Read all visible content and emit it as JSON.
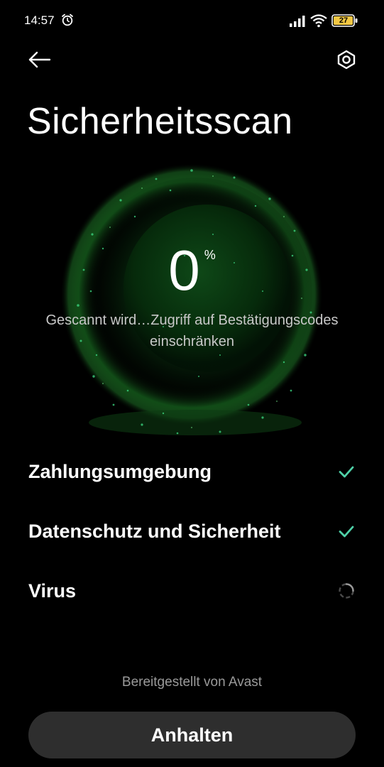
{
  "status_bar": {
    "time": "14:57",
    "battery_level": "27",
    "icons": [
      "alarm-icon",
      "signal-icon",
      "wifi-icon",
      "battery-icon"
    ]
  },
  "header": {
    "back_icon": "arrow-left-icon",
    "settings_icon": "gear-icon",
    "title": "Sicherheitsscan"
  },
  "scan": {
    "progress_value": "0",
    "progress_unit": "%",
    "status_text": "Gescannt wird…Zugriff auf Bestätigungscodes einschränken"
  },
  "checklist": [
    {
      "label": "Zahlungsumgebung",
      "state": "done",
      "icon": "checkmark-icon"
    },
    {
      "label": "Datenschutz und Sicherheit",
      "state": "done",
      "icon": "checkmark-icon"
    },
    {
      "label": "Virus",
      "state": "in-progress",
      "icon": "loading-spinner-icon"
    }
  ],
  "footer": {
    "provided_by": "Bereitgestellt von Avast",
    "stop_button_label": "Anhalten"
  },
  "colors": {
    "background": "#000000",
    "accent_green": "#3ddc84",
    "check_color": "#4fd1a8",
    "button_bg": "#2e2e2e",
    "secondary_text": "#9a9a9a"
  }
}
